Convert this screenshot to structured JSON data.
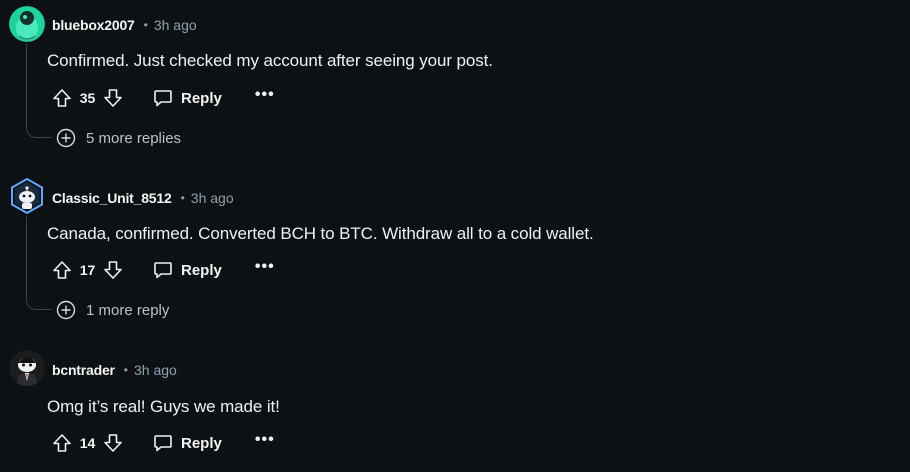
{
  "comments": [
    {
      "username": "bluebox2007",
      "time": "3h ago",
      "body": "Confirmed. Just checked my account after seeing your post.",
      "score": "35",
      "reply_label": "Reply",
      "more_label": "•••",
      "more_replies": "5 more replies",
      "avatar_icon": "snoo-teal-avatar"
    },
    {
      "username": "Classic_Unit_8512",
      "time": "3h ago",
      "body": "Canada, confirmed. Converted BCH to BTC. Withdraw all to a cold wallet.",
      "score": "17",
      "reply_label": "Reply",
      "more_label": "•••",
      "more_replies": "1 more reply",
      "avatar_icon": "snoo-hex-avatar"
    },
    {
      "username": "bcntrader",
      "time": "3h ago",
      "body": "Omg it’s real! Guys we made it!",
      "score": "14",
      "reply_label": "Reply",
      "more_label": "•••",
      "avatar_icon": "snoo-suit-avatar"
    }
  ],
  "separator": "•",
  "colors": {
    "background": "#0e1113",
    "text": "#eef1f3",
    "meta": "#8ba2ad",
    "thread_line": "#33464c"
  }
}
